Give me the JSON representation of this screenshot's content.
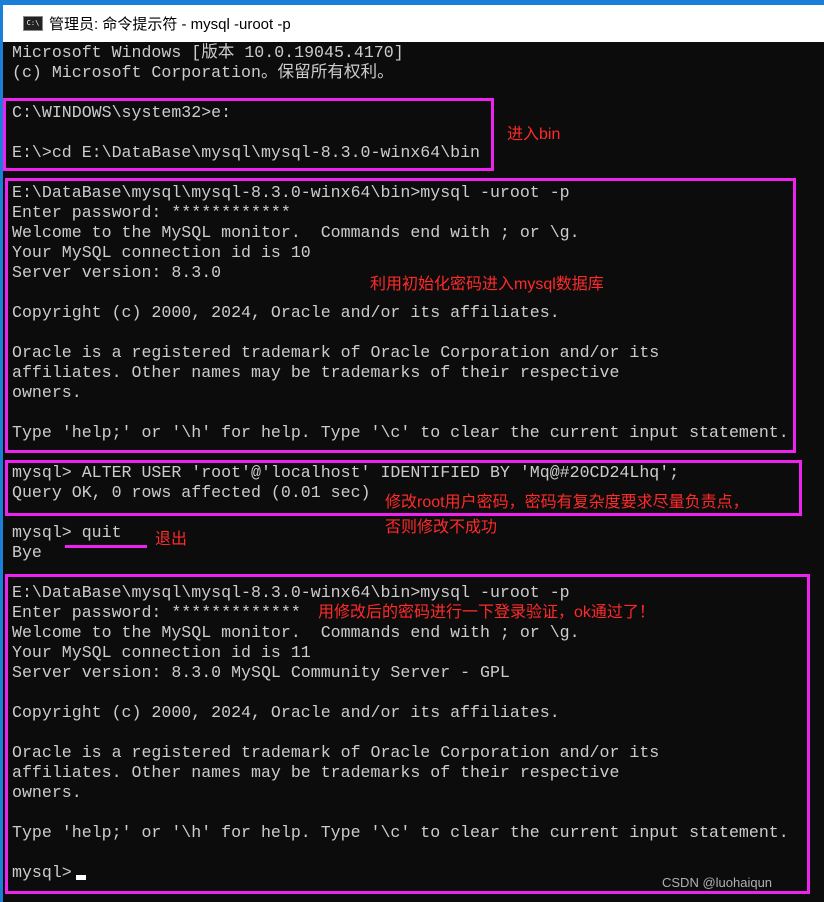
{
  "window": {
    "title": "管理员: 命令提示符 - mysql  -uroot -p",
    "icon": "cmd-icon"
  },
  "terminal": {
    "lines": [
      "Microsoft Windows [版本 10.0.19045.4170]",
      "(c) Microsoft Corporation。保留所有权利。",
      "",
      "C:\\WINDOWS\\system32>e:",
      "",
      "E:\\>cd E:\\DataBase\\mysql\\mysql-8.3.0-winx64\\bin",
      "",
      "E:\\DataBase\\mysql\\mysql-8.3.0-winx64\\bin>mysql -uroot -p",
      "Enter password: ************",
      "Welcome to the MySQL monitor.  Commands end with ; or \\g.",
      "Your MySQL connection id is 10",
      "Server version: 8.3.0",
      "",
      "Copyright (c) 2000, 2024, Oracle and/or its affiliates.",
      "",
      "Oracle is a registered trademark of Oracle Corporation and/or its",
      "affiliates. Other names may be trademarks of their respective",
      "owners.",
      "",
      "Type 'help;' or '\\h' for help. Type '\\c' to clear the current input statement.",
      "",
      "mysql> ALTER USER 'root'@'localhost' IDENTIFIED BY 'Mq@#20CD24Lhq';",
      "Query OK, 0 rows affected (0.01 sec)",
      "",
      "mysql> quit",
      "Bye",
      "",
      "E:\\DataBase\\mysql\\mysql-8.3.0-winx64\\bin>mysql -uroot -p",
      "Enter password: *************",
      "Welcome to the MySQL monitor.  Commands end with ; or \\g.",
      "Your MySQL connection id is 11",
      "Server version: 8.3.0 MySQL Community Server - GPL",
      "",
      "Copyright (c) 2000, 2024, Oracle and/or its affiliates.",
      "",
      "Oracle is a registered trademark of Oracle Corporation and/or its",
      "affiliates. Other names may be trademarks of their respective",
      "owners.",
      "",
      "Type 'help;' or '\\h' for help. Type '\\c' to clear the current input statement.",
      "",
      "mysql>"
    ]
  },
  "annotations": {
    "enter_bin": "进入bin",
    "login_initial": "利用初始化密码进入mysql数据库",
    "change_pw_1": "修改root用户密码，密码有复杂度要求尽量负责点，",
    "change_pw_2": "否则修改不成功",
    "quit": "退出",
    "verify": "用修改后的密码进行一下登录验证，ok通过了！",
    "box_color": "#ee22ee",
    "text_color": "#ff2a2a"
  },
  "watermark": "CSDN @luohaiqun"
}
